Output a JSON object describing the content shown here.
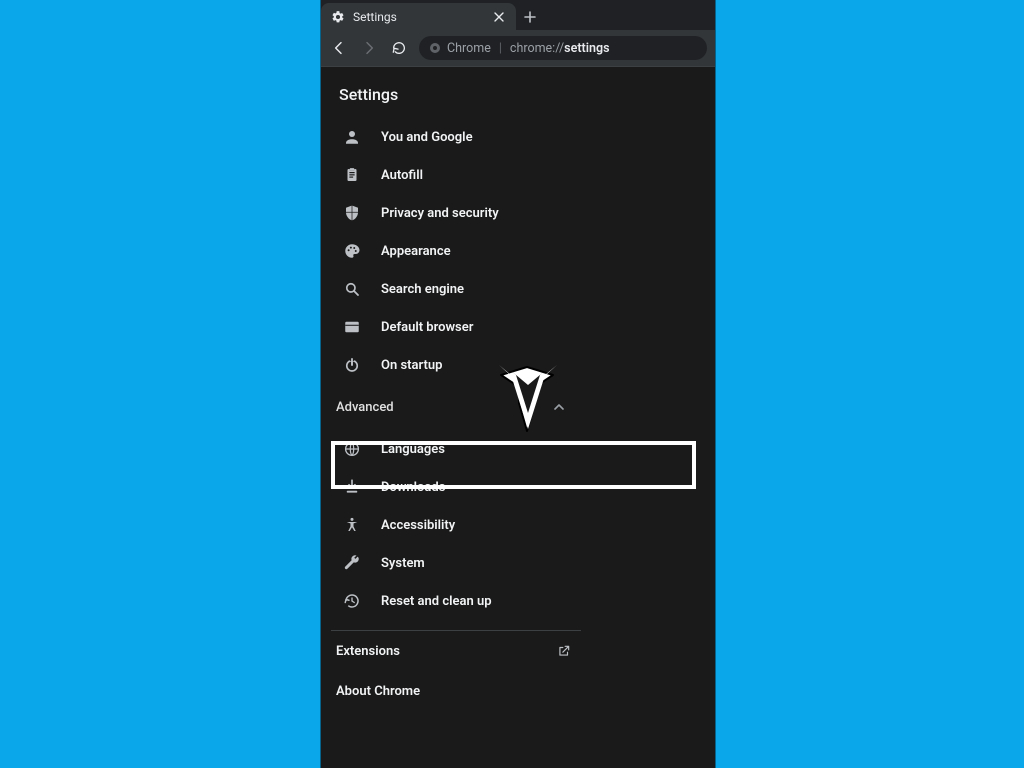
{
  "tab": {
    "title": "Settings"
  },
  "omnibox": {
    "scheme_label": "Chrome",
    "prefix": "chrome://",
    "path_bold": "settings"
  },
  "page": {
    "title": "Settings"
  },
  "nav": {
    "items": [
      {
        "label": "You and Google"
      },
      {
        "label": "Autofill"
      },
      {
        "label": "Privacy and security"
      },
      {
        "label": "Appearance"
      },
      {
        "label": "Search engine"
      },
      {
        "label": "Default browser"
      },
      {
        "label": "On startup"
      }
    ],
    "advanced_label": "Advanced",
    "advanced_items": [
      {
        "label": "Languages"
      },
      {
        "label": "Downloads"
      },
      {
        "label": "Accessibility"
      },
      {
        "label": "System"
      },
      {
        "label": "Reset and clean up"
      }
    ]
  },
  "bottom": {
    "extensions": "Extensions",
    "about": "About Chrome"
  }
}
